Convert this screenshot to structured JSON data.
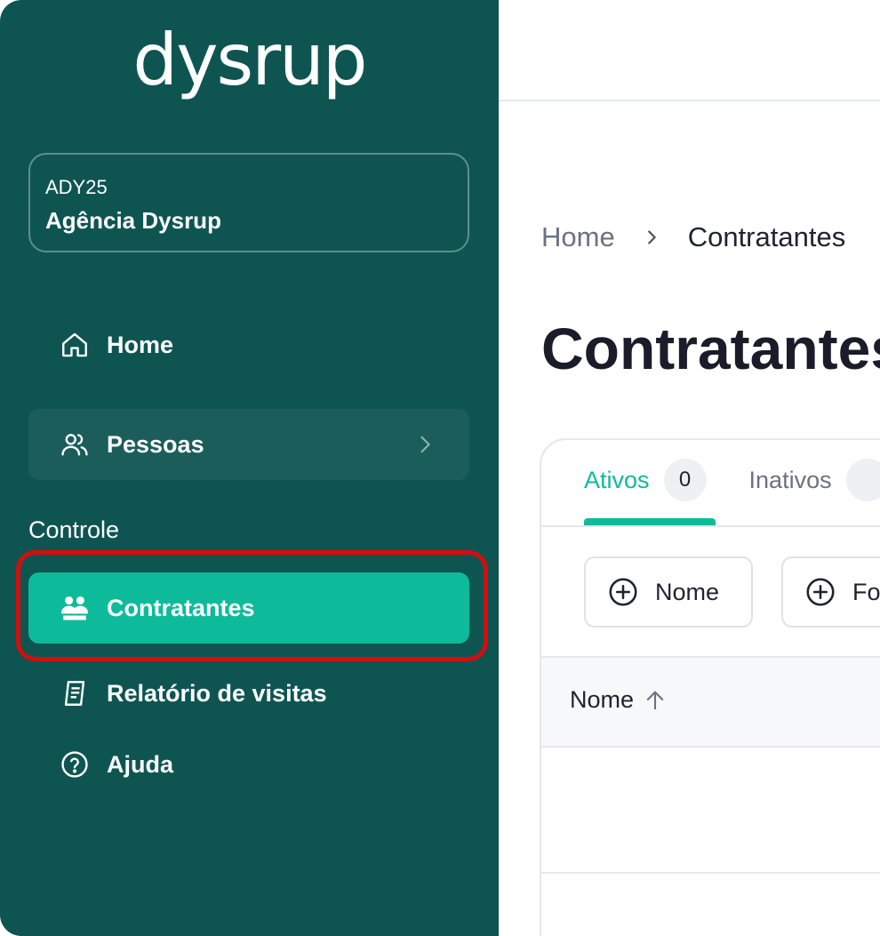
{
  "brand": {
    "logo_text": "dysrup"
  },
  "organization": {
    "code": "ADY25",
    "name": "Agência Dysrup"
  },
  "sidebar": {
    "items": [
      {
        "label": "Home",
        "icon": "home-icon"
      },
      {
        "label": "Pessoas",
        "icon": "users-icon",
        "has_submenu": true
      }
    ],
    "section_label": "Controle",
    "section_items": [
      {
        "label": "Contratantes",
        "icon": "contractors-icon",
        "active": true
      },
      {
        "label": "Relatório de visitas",
        "icon": "report-icon"
      },
      {
        "label": "Ajuda",
        "icon": "help-icon"
      }
    ]
  },
  "breadcrumb": {
    "home": "Home",
    "current": "Contratantes"
  },
  "page": {
    "title": "Contratantes"
  },
  "tabs": [
    {
      "label": "Ativos",
      "count": "0",
      "active": true
    },
    {
      "label": "Inativos",
      "count": "",
      "active": false
    }
  ],
  "filters": [
    {
      "label": "Nome"
    },
    {
      "label": "Fo"
    }
  ],
  "table": {
    "columns": [
      {
        "label": "Nome",
        "sort": "ascending"
      }
    ]
  },
  "colors": {
    "sidebar_bg": "#0e5552",
    "accent": "#0dbb9b",
    "highlight": "#d40d0d"
  }
}
